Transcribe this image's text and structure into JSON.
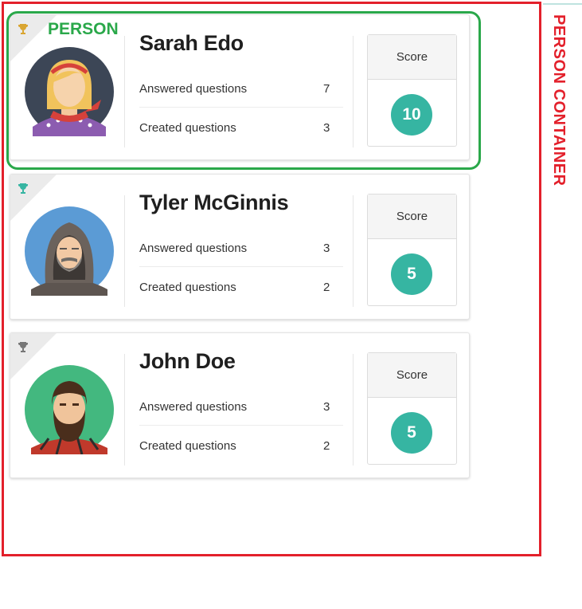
{
  "annotations": {
    "person_label": "PERSON",
    "person_container_label": "PERSON CONTAINER",
    "person_color": "#2aa84a",
    "container_color": "#e3202b"
  },
  "accent_color": "#36b5a2",
  "people": [
    {
      "name": "Sarah Edo",
      "trophy_icon": "trophy-gold-icon",
      "avatar_icon": "female-avatar-icon",
      "answered_label": "Answered questions",
      "answered_value": "7",
      "created_label": "Created questions",
      "created_value": "3",
      "score_label": "Score",
      "score_value": "10"
    },
    {
      "name": "Tyler McGinnis",
      "trophy_icon": "trophy-teal-icon",
      "avatar_icon": "hooded-bearded-avatar-icon",
      "answered_label": "Answered questions",
      "answered_value": "3",
      "created_label": "Created questions",
      "created_value": "2",
      "score_label": "Score",
      "score_value": "5"
    },
    {
      "name": "John Doe",
      "trophy_icon": "trophy-gray-icon",
      "avatar_icon": "bearded-man-avatar-icon",
      "answered_label": "Answered questions",
      "answered_value": "3",
      "created_label": "Created questions",
      "created_value": "2",
      "score_label": "Score",
      "score_value": "5"
    }
  ]
}
